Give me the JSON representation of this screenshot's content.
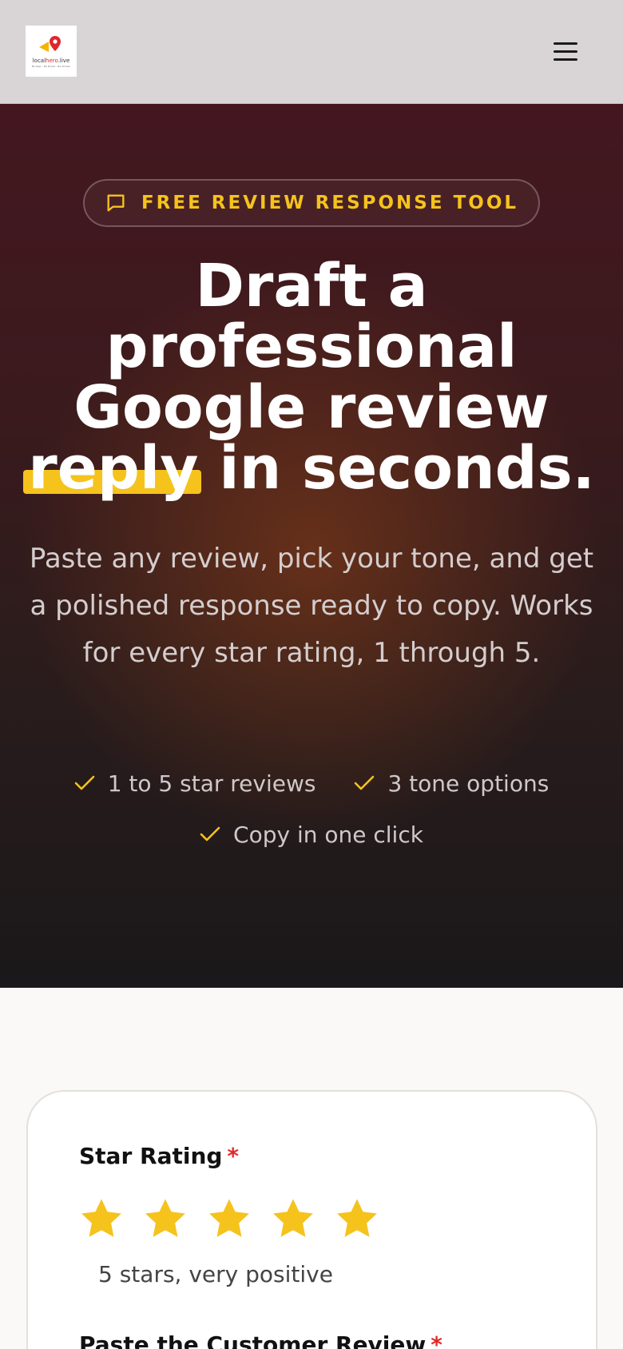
{
  "header": {
    "logo_text_a": "local",
    "logo_text_b": "hero",
    "logo_text_c": ".live",
    "logo_tagline": "Be Seen . Be Picked . Be Chosen",
    "menu_icon": "hamburger-menu-icon"
  },
  "hero": {
    "badge_icon": "chat-bubble-icon",
    "badge_label": "FREE REVIEW RESPONSE TOOL",
    "headline_part1": "Draft a professional Google review",
    "headline_highlight": "reply",
    "headline_part2": "in seconds.",
    "subtext": "Paste any review, pick your tone, and get a polished response ready to copy. Works for every star rating, 1 through 5.",
    "features": [
      {
        "icon": "check-icon",
        "label": "1 to 5 star reviews"
      },
      {
        "icon": "check-icon",
        "label": "3 tone options"
      },
      {
        "icon": "check-icon",
        "label": "Copy in one click"
      }
    ]
  },
  "form": {
    "star_rating_label": "Star Rating",
    "required_mark": "*",
    "rating_value": 5,
    "rating_max": 5,
    "rating_description": "5 stars, very positive",
    "review_label": "Paste the Customer Review"
  },
  "colors": {
    "accent": "#f5c31c",
    "required": "#e22a2a",
    "hero_dark": "#1a181a"
  }
}
